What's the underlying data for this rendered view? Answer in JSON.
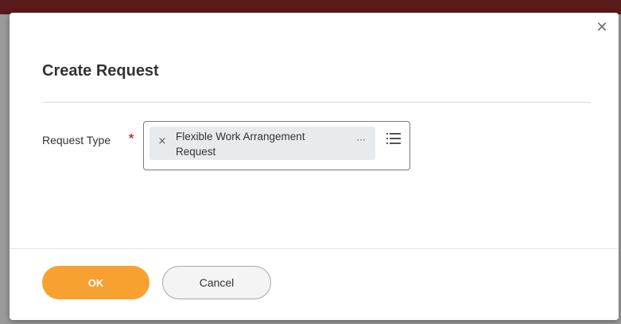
{
  "dialog": {
    "title": "Create Request",
    "close_icon": "close-icon"
  },
  "form": {
    "request_type": {
      "label": "Request Type",
      "required_marker": "*",
      "selected": {
        "text_line1": "Flexible Work Arrangement",
        "text_line2": "Request",
        "remove_glyph": "×",
        "more_glyph": "···"
      },
      "list_icon": "list-icon"
    }
  },
  "footer": {
    "ok_label": "OK",
    "cancel_label": "Cancel"
  },
  "colors": {
    "primary_button": "#f7a131",
    "required": "#d12d2d",
    "pill_background": "#e8ebee"
  }
}
